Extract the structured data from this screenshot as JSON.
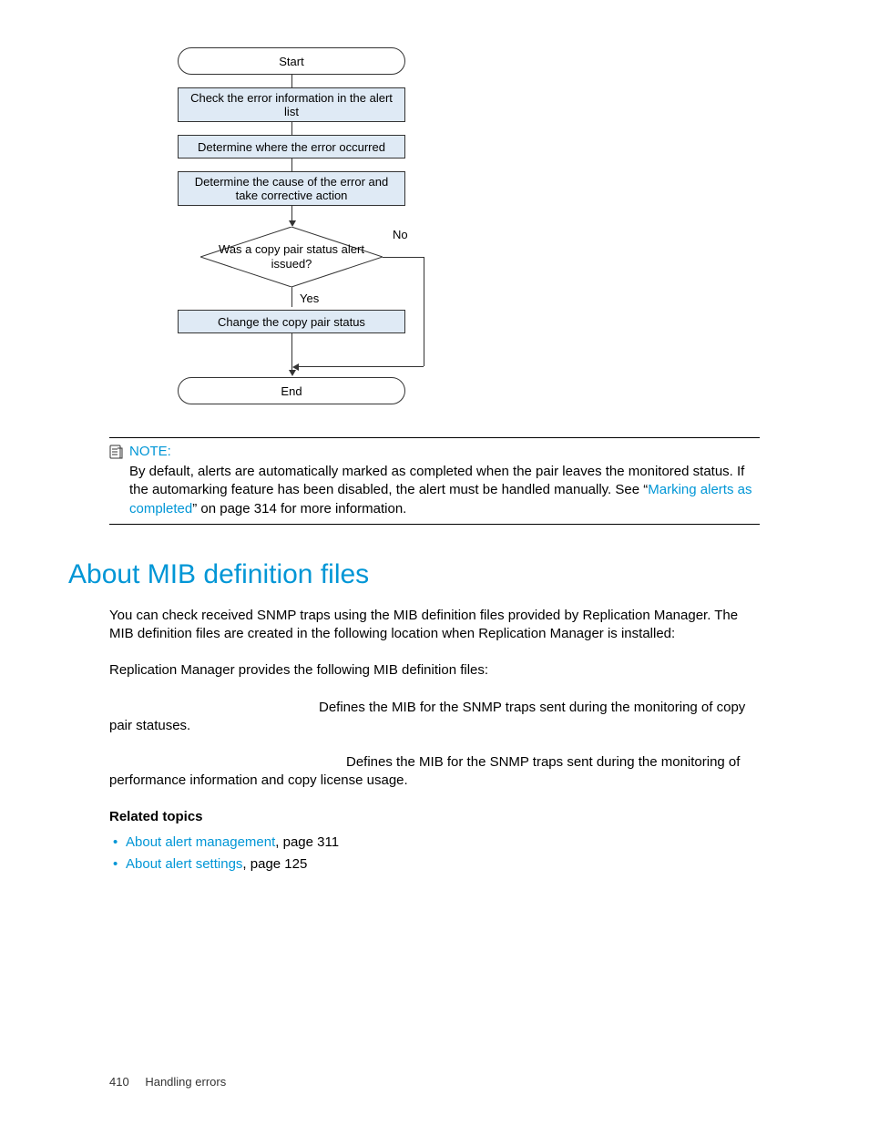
{
  "flowchart": {
    "start": "Start",
    "step1": "Check the error information in the alert list",
    "step2": "Determine where the error occurred",
    "step3": "Determine the cause of the error and take corrective action",
    "decision": "Was a copy pair status alert issued?",
    "no": "No",
    "yes": "Yes",
    "step4": "Change the copy pair status",
    "end": "End"
  },
  "note": {
    "label": "NOTE:",
    "body_pre": "By default, alerts are automatically marked as completed when the pair leaves the monitored status. If the automarking feature has been disabled, the alert must be handled manually. See “",
    "link": "Marking alerts as completed",
    "body_post": "” on page 314 for more information."
  },
  "section": {
    "title": "About MIB definition files",
    "p1": "You can check received SNMP traps using the MIB definition files provided by Replication Manager. The MIB definition files are created in the following location when Replication Manager is installed:",
    "p2": "Replication Manager provides the following MIB definition files:",
    "def1": "Defines the MIB for the SNMP traps sent during the monitoring of copy pair statuses.",
    "def2": "Defines the MIB for the SNMP traps sent during the monitoring of performance information and copy license usage."
  },
  "related": {
    "heading": "Related topics",
    "items": [
      {
        "link": "About alert management",
        "rest": ", page 311"
      },
      {
        "link": "About alert settings",
        "rest": ", page 125"
      }
    ]
  },
  "footer": {
    "page": "410",
    "chapter": "Handling errors"
  }
}
